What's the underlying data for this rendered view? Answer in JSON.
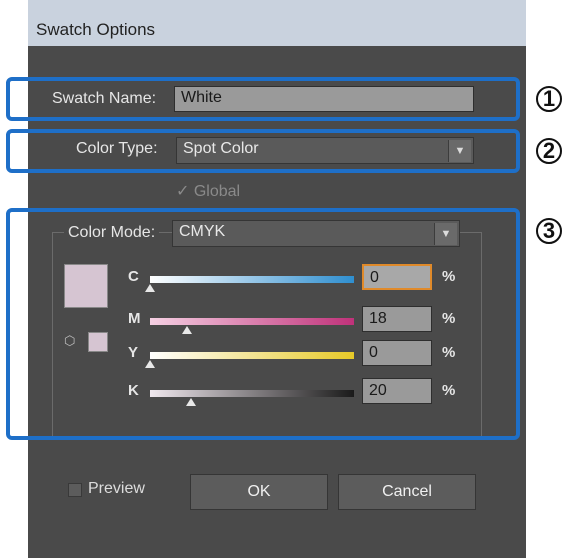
{
  "dialog": {
    "title": "Swatch Options"
  },
  "swatch_name": {
    "label": "Swatch Name:",
    "value": "White"
  },
  "color_type": {
    "label": "Color Type:",
    "value": "Spot Color"
  },
  "global": {
    "label": "Global",
    "checked": true
  },
  "color_mode": {
    "label": "Color Mode:",
    "value": "CMYK"
  },
  "swatch_color": "#d6c5d2",
  "channels": [
    {
      "label": "C",
      "value": "0",
      "unit": "%",
      "level": 0.0
    },
    {
      "label": "M",
      "value": "18",
      "unit": "%",
      "level": 0.18
    },
    {
      "label": "Y",
      "value": "0",
      "unit": "%",
      "level": 0.0
    },
    {
      "label": "K",
      "value": "20",
      "unit": "%",
      "level": 0.2
    }
  ],
  "preview": {
    "label": "Preview",
    "checked": false
  },
  "buttons": {
    "ok": "OK",
    "cancel": "Cancel"
  },
  "callouts": [
    "1",
    "2",
    "3"
  ],
  "colors": {
    "highlight": "#1e6fc8",
    "panel": "#4a4a4a",
    "titlebar": "#c9d2de"
  }
}
